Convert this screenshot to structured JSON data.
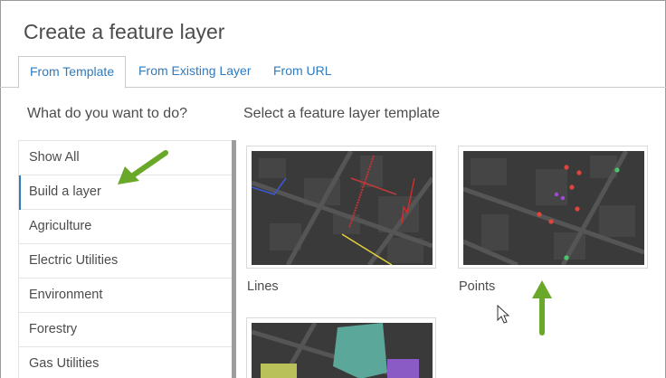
{
  "dialog": {
    "title": "Create a feature layer"
  },
  "tabs": [
    {
      "label": "From Template",
      "active": true
    },
    {
      "label": "From Existing Layer",
      "active": false
    },
    {
      "label": "From URL",
      "active": false
    }
  ],
  "sidebar": {
    "heading": "What do you want to do?",
    "items": [
      {
        "label": "Show All"
      },
      {
        "label": "Build a layer",
        "active": true
      },
      {
        "label": "Agriculture"
      },
      {
        "label": "Electric Utilities"
      },
      {
        "label": "Environment"
      },
      {
        "label": "Forestry"
      },
      {
        "label": "Gas Utilities"
      }
    ]
  },
  "main": {
    "heading": "Select a feature layer template",
    "templates": [
      {
        "label": "Lines",
        "icon": "lines-template-thumbnail"
      },
      {
        "label": "Points",
        "icon": "points-template-thumbnail"
      },
      {
        "label": "",
        "icon": "polygons-template-thumbnail"
      }
    ]
  },
  "colors": {
    "accent": "#2f7bbd",
    "annotation_arrow": "#6aa829",
    "map_background": "#3a3a3a"
  }
}
